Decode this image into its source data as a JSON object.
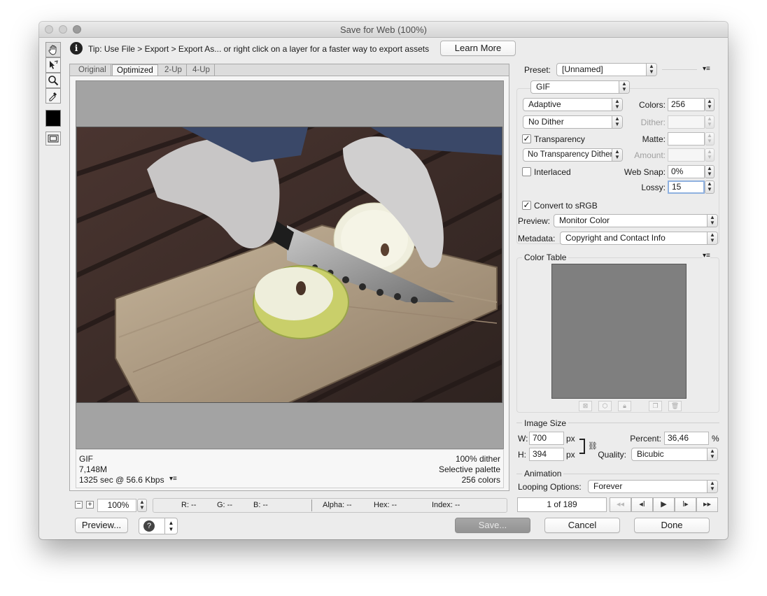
{
  "window": {
    "title": "Save for Web (100%)"
  },
  "tip": {
    "text": "Tip: Use File > Export > Export As...  or right click on a layer for a faster way to export assets",
    "learn_more": "Learn More"
  },
  "tools": [
    "hand-tool",
    "slice-select-tool",
    "zoom-tool",
    "eyedropper-tool",
    "eyedropper-color",
    "toggle-slices-visibility"
  ],
  "view_tabs": [
    "Original",
    "Optimized",
    "2-Up",
    "4-Up"
  ],
  "image_info": {
    "format": "GIF",
    "size": "7,148M",
    "time": "1325 sec @ 56.6 Kbps",
    "dither": "100% dither",
    "palette": "Selective palette",
    "colors": "256 colors"
  },
  "status_bar": {
    "zoom": "100%",
    "r": "R: --",
    "g": "G: --",
    "b": "B: --",
    "alpha": "Alpha: --",
    "hex": "Hex: --",
    "index": "Index: --"
  },
  "bottom_buttons": {
    "preview": "Preview...",
    "save": "Save...",
    "cancel": "Cancel",
    "done": "Done"
  },
  "settings": {
    "preset_label": "Preset:",
    "preset_value": "[Unnamed]",
    "format": "GIF",
    "reduction": "Adaptive",
    "colors_label": "Colors:",
    "colors_value": "256",
    "dither_algo": "No Dither",
    "dither_label": "Dither:",
    "dither_value": "",
    "transparency_label": "Transparency",
    "transparency_checked": true,
    "matte_label": "Matte:",
    "transparency_dither": "No Transparency Dither",
    "amount_label": "Amount:",
    "interlaced_label": "Interlaced",
    "interlaced_checked": false,
    "websnap_label": "Web Snap:",
    "websnap_value": "0%",
    "lossy_label": "Lossy:",
    "lossy_value": "15",
    "convert_label": "Convert to sRGB",
    "convert_checked": true,
    "preview_label": "Preview:",
    "preview_value": "Monitor Color",
    "metadata_label": "Metadata:",
    "metadata_value": "Copyright and Contact Info"
  },
  "color_table": {
    "title": "Color Table"
  },
  "image_size": {
    "title": "Image Size",
    "w_label": "W:",
    "w_value": "700",
    "w_unit": "px",
    "h_label": "H:",
    "h_value": "394",
    "h_unit": "px",
    "percent_label": "Percent:",
    "percent_value": "36,46",
    "percent_unit": "%",
    "quality_label": "Quality:",
    "quality_value": "Bicubic"
  },
  "animation": {
    "title": "Animation",
    "looping_label": "Looping Options:",
    "looping_value": "Forever",
    "frame_counter": "1 of 189"
  },
  "colors": {
    "window_bg": "#ececec",
    "canvas_bg": "#a3a3a3",
    "color_table_bg": "#7f7f7f"
  }
}
